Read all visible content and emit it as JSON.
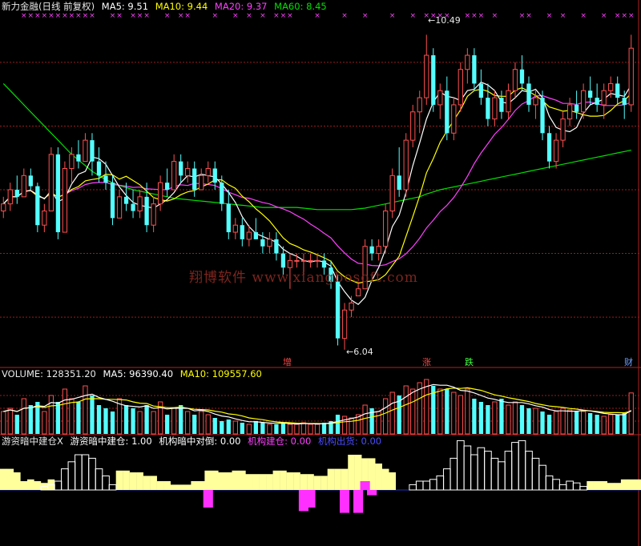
{
  "header": {
    "title": "新力金融(日线 前复权)",
    "ma5": "MA5: 9.51",
    "ma10": "MA10: 9.44",
    "ma20": "MA20: 9.37",
    "ma60": "MA60: 8.45"
  },
  "volume_header": {
    "label": "VOLUME: 128351.20",
    "ma5": "MA5: 96390.40",
    "ma10": "MA10: 109557.60"
  },
  "indicator_header": {
    "name": "游资暗中建仓X",
    "v1": "游资暗中建仓: 1.00",
    "v2": "机构暗中对倒: 0.00",
    "v3": "机构建仓: 0.00",
    "v4": "机构出货: 0.00"
  },
  "annotations": {
    "high": "10.49",
    "low": "6.04"
  },
  "event_markers": [
    "增",
    "涨",
    "跌",
    "财"
  ],
  "watermark": "翔博软件 www.xiangbosoft.com",
  "colors": {
    "up": "#ff5050",
    "down": "#54ffff",
    "ma5": "#ffffff",
    "ma10": "#ffff00",
    "ma20": "#ff40ff",
    "ma60": "#00e000",
    "grid": "#9b1c1c",
    "bar_yellow": "#ffff9c",
    "bar_magenta": "#ff30ff",
    "marker": "#ff40ff"
  },
  "chart_data": {
    "type": "candlestick",
    "price_ylim": [
      5.8,
      10.8
    ],
    "price_gridlines": [
      10.1,
      9.2,
      8.3,
      7.4,
      6.5
    ],
    "candles": [
      [
        8.0,
        8.2,
        7.9,
        8.1
      ],
      [
        8.1,
        8.4,
        8.0,
        8.3
      ],
      [
        8.3,
        8.5,
        8.1,
        8.2
      ],
      [
        8.2,
        8.6,
        8.2,
        8.5
      ],
      [
        8.5,
        8.6,
        8.3,
        8.35
      ],
      [
        8.35,
        8.4,
        7.7,
        7.8
      ],
      [
        7.8,
        8.1,
        7.7,
        8.0
      ],
      [
        8.0,
        8.9,
        8.0,
        8.8
      ],
      [
        8.8,
        8.9,
        7.6,
        7.7
      ],
      [
        7.7,
        8.7,
        7.7,
        8.6
      ],
      [
        8.6,
        8.9,
        8.4,
        8.8
      ],
      [
        8.8,
        9.0,
        8.6,
        8.7
      ],
      [
        8.7,
        9.1,
        8.7,
        9.0
      ],
      [
        9.0,
        9.1,
        8.5,
        8.7
      ],
      [
        8.7,
        8.9,
        8.4,
        8.5
      ],
      [
        8.5,
        8.7,
        8.3,
        8.4
      ],
      [
        8.4,
        8.5,
        7.8,
        7.9
      ],
      [
        7.9,
        8.3,
        7.9,
        8.2
      ],
      [
        8.2,
        8.4,
        8.0,
        8.1
      ],
      [
        8.1,
        8.3,
        7.9,
        8.0
      ],
      [
        8.0,
        8.3,
        7.9,
        8.2
      ],
      [
        8.2,
        8.4,
        7.7,
        7.8
      ],
      [
        7.8,
        8.2,
        7.7,
        8.1
      ],
      [
        8.1,
        8.5,
        8.0,
        8.4
      ],
      [
        8.4,
        8.6,
        8.2,
        8.3
      ],
      [
        8.3,
        8.8,
        8.3,
        8.7
      ],
      [
        8.7,
        8.8,
        8.4,
        8.5
      ],
      [
        8.5,
        8.7,
        8.4,
        8.6
      ],
      [
        8.6,
        8.7,
        8.2,
        8.3
      ],
      [
        8.3,
        8.6,
        8.3,
        8.5
      ],
      [
        8.5,
        8.7,
        8.4,
        8.6
      ],
      [
        8.6,
        8.7,
        8.3,
        8.4
      ],
      [
        8.4,
        8.5,
        8.0,
        8.1
      ],
      [
        8.1,
        8.3,
        7.6,
        7.7
      ],
      [
        7.7,
        7.9,
        7.6,
        7.8
      ],
      [
        7.8,
        7.9,
        7.5,
        7.6
      ],
      [
        7.6,
        7.8,
        7.5,
        7.7
      ],
      [
        7.7,
        7.9,
        7.6,
        7.6
      ],
      [
        7.6,
        7.7,
        7.4,
        7.5
      ],
      [
        7.5,
        7.7,
        7.4,
        7.6
      ],
      [
        7.6,
        7.7,
        7.3,
        7.4
      ],
      [
        7.4,
        7.5,
        7.1,
        7.2
      ],
      [
        7.2,
        7.4,
        6.9,
        7.3
      ],
      [
        7.3,
        7.4,
        7.2,
        7.3
      ],
      [
        7.3,
        7.4,
        7.1,
        7.3
      ],
      [
        7.3,
        7.4,
        7.2,
        7.3
      ],
      [
        7.3,
        7.4,
        7.2,
        7.3
      ],
      [
        7.3,
        7.4,
        7.1,
        7.2
      ],
      [
        7.2,
        7.3,
        6.9,
        7.0
      ],
      [
        7.0,
        7.1,
        6.1,
        6.2
      ],
      [
        6.2,
        6.7,
        6.04,
        6.6
      ],
      [
        6.6,
        6.8,
        6.5,
        6.7
      ],
      [
        6.8,
        7.0,
        6.8,
        6.9
      ],
      [
        6.9,
        7.6,
        6.9,
        7.5
      ],
      [
        7.5,
        7.6,
        7.3,
        7.4
      ],
      [
        7.4,
        7.6,
        7.3,
        7.5
      ],
      [
        7.5,
        8.1,
        7.4,
        8.0
      ],
      [
        8.0,
        8.6,
        7.9,
        8.5
      ],
      [
        8.5,
        8.9,
        8.2,
        8.3
      ],
      [
        8.3,
        9.1,
        8.2,
        9.0
      ],
      [
        9.0,
        9.5,
        8.9,
        9.4
      ],
      [
        9.4,
        9.7,
        9.1,
        9.6
      ],
      [
        9.6,
        10.49,
        9.5,
        10.2
      ],
      [
        10.2,
        10.3,
        9.4,
        9.5
      ],
      [
        9.5,
        9.8,
        9.3,
        9.7
      ],
      [
        9.7,
        9.9,
        9.0,
        9.1
      ],
      [
        9.1,
        9.6,
        9.0,
        9.5
      ],
      [
        9.5,
        10.1,
        9.4,
        10.0
      ],
      [
        10.0,
        10.3,
        9.8,
        10.2
      ],
      [
        10.2,
        10.3,
        9.7,
        9.8
      ],
      [
        9.8,
        10.0,
        9.5,
        9.6
      ],
      [
        9.6,
        9.8,
        9.2,
        9.3
      ],
      [
        9.3,
        9.7,
        9.2,
        9.6
      ],
      [
        9.6,
        9.7,
        9.3,
        9.4
      ],
      [
        9.4,
        9.8,
        9.3,
        9.7
      ],
      [
        9.7,
        10.1,
        9.6,
        10.0
      ],
      [
        10.0,
        10.2,
        9.7,
        9.8
      ],
      [
        9.8,
        9.9,
        9.4,
        9.5
      ],
      [
        9.5,
        9.7,
        9.3,
        9.6
      ],
      [
        9.6,
        9.7,
        9.0,
        9.1
      ],
      [
        9.1,
        9.2,
        8.6,
        8.7
      ],
      [
        8.7,
        9.1,
        8.6,
        9.0
      ],
      [
        9.0,
        9.4,
        8.9,
        9.3
      ],
      [
        9.3,
        9.6,
        9.2,
        9.5
      ],
      [
        9.5,
        9.7,
        9.3,
        9.4
      ],
      [
        9.4,
        9.8,
        9.3,
        9.7
      ],
      [
        9.7,
        9.9,
        9.5,
        9.6
      ],
      [
        9.6,
        9.8,
        9.4,
        9.5
      ],
      [
        9.5,
        9.8,
        9.3,
        9.7
      ],
      [
        9.7,
        9.9,
        9.6,
        9.8
      ],
      [
        9.8,
        9.9,
        9.5,
        9.6
      ],
      [
        9.6,
        9.7,
        9.3,
        9.5
      ],
      [
        9.5,
        10.49,
        9.4,
        10.3
      ]
    ],
    "ma60": [
      9.8,
      9.7,
      9.6,
      9.5,
      9.4,
      9.3,
      9.2,
      9.1,
      9.0,
      8.9,
      8.8,
      8.72,
      8.64,
      8.56,
      8.5,
      8.44,
      8.4,
      8.36,
      8.33,
      8.3,
      8.28,
      8.26,
      8.24,
      8.22,
      8.2,
      8.18,
      8.17,
      8.16,
      8.15,
      8.14,
      8.13,
      8.12,
      8.11,
      8.1,
      8.09,
      8.08,
      8.07,
      8.06,
      8.05,
      8.05,
      8.05,
      8.05,
      8.05,
      8.05,
      8.04,
      8.03,
      8.02,
      8.02,
      8.02,
      8.02,
      8.02,
      8.02,
      8.03,
      8.04,
      8.06,
      8.08,
      8.1,
      8.12,
      8.14,
      8.16,
      8.18,
      8.2,
      8.24,
      8.27,
      8.3,
      8.32,
      8.34,
      8.36,
      8.38,
      8.4,
      8.42,
      8.44,
      8.46,
      8.48,
      8.5,
      8.52,
      8.54,
      8.56,
      8.58,
      8.6,
      8.62,
      8.64,
      8.66,
      8.68,
      8.7,
      8.72,
      8.74,
      8.76,
      8.78,
      8.8,
      8.82,
      8.84,
      8.86
    ],
    "volume_ylim": [
      0,
      170000
    ],
    "volume": [
      70,
      80,
      60,
      110,
      90,
      100,
      70,
      120,
      100,
      140,
      110,
      100,
      150,
      120,
      90,
      80,
      70,
      110,
      90,
      80,
      70,
      90,
      70,
      100,
      60,
      80,
      90,
      70,
      60,
      70,
      60,
      50,
      40,
      45,
      40,
      35,
      30,
      40,
      35,
      30,
      30,
      35,
      30,
      30,
      35,
      30,
      30,
      35,
      40,
      60,
      55,
      50,
      60,
      90,
      80,
      70,
      110,
      130,
      120,
      150,
      140,
      160,
      170,
      150,
      140,
      140,
      130,
      120,
      140,
      110,
      100,
      90,
      100,
      110,
      90,
      100,
      90,
      80,
      80,
      70,
      60,
      70,
      80,
      75,
      70,
      70,
      65,
      60,
      55,
      60,
      60,
      65,
      128
    ],
    "indicator_ylim": [
      -2,
      3
    ],
    "indicator_yellow": [
      1.2,
      1.2,
      1.0,
      0.5,
      0.6,
      0.5,
      0.4,
      0.6,
      0,
      0,
      0,
      0,
      0,
      0,
      0,
      0,
      0,
      1.1,
      1.1,
      1.0,
      1.0,
      0.8,
      0.8,
      0.5,
      0.5,
      0.3,
      0.3,
      0.3,
      0.5,
      0.5,
      1.1,
      1.1,
      1.0,
      1.0,
      1.1,
      1.1,
      0.9,
      0.9,
      0.9,
      0.9,
      1.1,
      1.1,
      1.0,
      1.0,
      0.9,
      0.9,
      0.8,
      0.8,
      1.2,
      1.2,
      1.2,
      2.0,
      2.0,
      1.8,
      1.8,
      1.5,
      1.2,
      1.0,
      0,
      0,
      0,
      0,
      0,
      0,
      0,
      0,
      0,
      0,
      0,
      0,
      0,
      0,
      0,
      0,
      0,
      0,
      0,
      0,
      0,
      0,
      0,
      0,
      0,
      0,
      0,
      0,
      0.5,
      0.5,
      0.5,
      0.4,
      0.4,
      0.6,
      0.6,
      0.6
    ],
    "indicator_outline": [
      0,
      0,
      0,
      0,
      0,
      0,
      0.2,
      0.3,
      0.5,
      1.2,
      1.6,
      2.0,
      2.0,
      1.8,
      1.2,
      0.8,
      0.3,
      0,
      0,
      0,
      0,
      0,
      0,
      0,
      0,
      0,
      0,
      0,
      0,
      0,
      0,
      0,
      0,
      0,
      0,
      0,
      0,
      0,
      0,
      0,
      0,
      0,
      0,
      0,
      0,
      0,
      0,
      0,
      0,
      0,
      0,
      0,
      0,
      0,
      0,
      0,
      0,
      0,
      0,
      0,
      0.3,
      0.5,
      0.5,
      0.6,
      0.8,
      1.2,
      1.8,
      2.8,
      2.5,
      2.0,
      2.4,
      2.2,
      1.8,
      1.6,
      2.2,
      2.7,
      2.8,
      2.2,
      1.8,
      1.4,
      0.8,
      0.6,
      0.3,
      0.5,
      0.4,
      0.2,
      0,
      0,
      0,
      0,
      0,
      0,
      0
    ],
    "indicator_magenta": [
      0,
      0,
      0,
      0,
      0,
      0,
      0,
      0,
      0,
      0,
      0,
      0,
      0,
      0,
      0,
      0,
      0,
      0,
      0,
      0,
      0,
      0,
      0,
      0,
      0,
      0,
      0,
      0,
      0,
      0,
      -1.0,
      0,
      0,
      0,
      0,
      0,
      0,
      0,
      0,
      0,
      0,
      0,
      0,
      0,
      -1.2,
      -1.0,
      0,
      0,
      0,
      0,
      -1.3,
      0,
      -1.3,
      0.5,
      -0.3,
      0,
      0,
      0,
      0,
      0,
      0,
      0,
      0,
      0,
      0,
      0,
      0,
      0,
      0,
      0,
      0,
      0,
      0,
      0,
      0,
      0,
      0,
      0,
      0,
      0,
      0,
      0,
      0,
      0,
      0,
      0,
      0,
      0,
      0,
      0,
      0,
      0,
      0
    ]
  }
}
